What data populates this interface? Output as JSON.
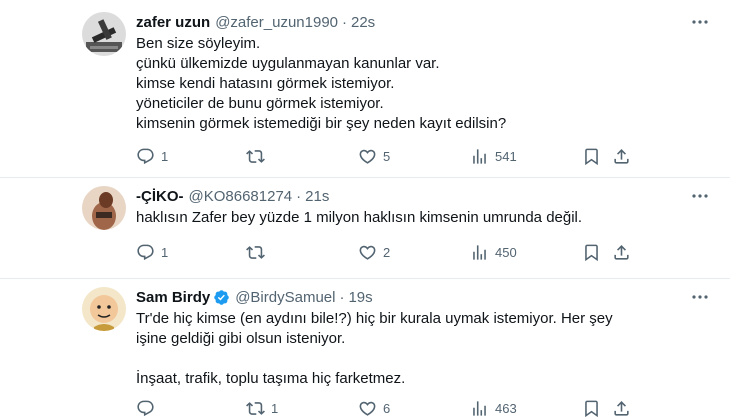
{
  "tweets": [
    {
      "name": "zafer uzun",
      "handle": "@zafer_uzun1990",
      "dot": "·",
      "time": "22s",
      "verified": false,
      "lines": [
        "Ben size söyleyim.",
        "çünkü ülkemizde uygulanmayan kanunlar var.",
        "kimse kendi hatasını görmek istemiyor.",
        "yöneticiler de bunu görmek istemiyor.",
        "kimsenin görmek istemediği bir şey neden kayıt edilsin?"
      ],
      "replies": "1",
      "retweets": "",
      "likes": "5",
      "views": "541"
    },
    {
      "name": "-ÇİKO-",
      "handle": "@KO86681274",
      "dot": "·",
      "time": "21s",
      "verified": false,
      "lines": [
        "haklısın Zafer bey yüzde 1 milyon haklısın kimsenin umrunda değil."
      ],
      "replies": "1",
      "retweets": "",
      "likes": "2",
      "views": "450"
    },
    {
      "name": "Sam Birdy",
      "handle": "@BirdySamuel",
      "dot": "·",
      "time": "19s",
      "verified": true,
      "lines": [
        "Tr'de hiç kimse (en aydını bile!?) hiç bir kurala uymak istemiyor. Her şey",
        "işine geldiği gibi olsun isteniyor.",
        "",
        "İnşaat, trafik, toplu taşıma hiç farketmez."
      ],
      "replies": "",
      "retweets": "1",
      "likes": "6",
      "views": "463"
    }
  ],
  "icons": {
    "reply": "reply-icon",
    "retweet": "retweet-icon",
    "like": "heart-icon",
    "views": "views-icon",
    "bookmark": "bookmark-icon",
    "share": "share-icon",
    "more": "more-icon",
    "verified": "verified-badge-icon"
  },
  "colors": {
    "text": "#0f1419",
    "muted": "#536471",
    "verified": "#1d9bf0",
    "divider": "#e6ecf0"
  }
}
